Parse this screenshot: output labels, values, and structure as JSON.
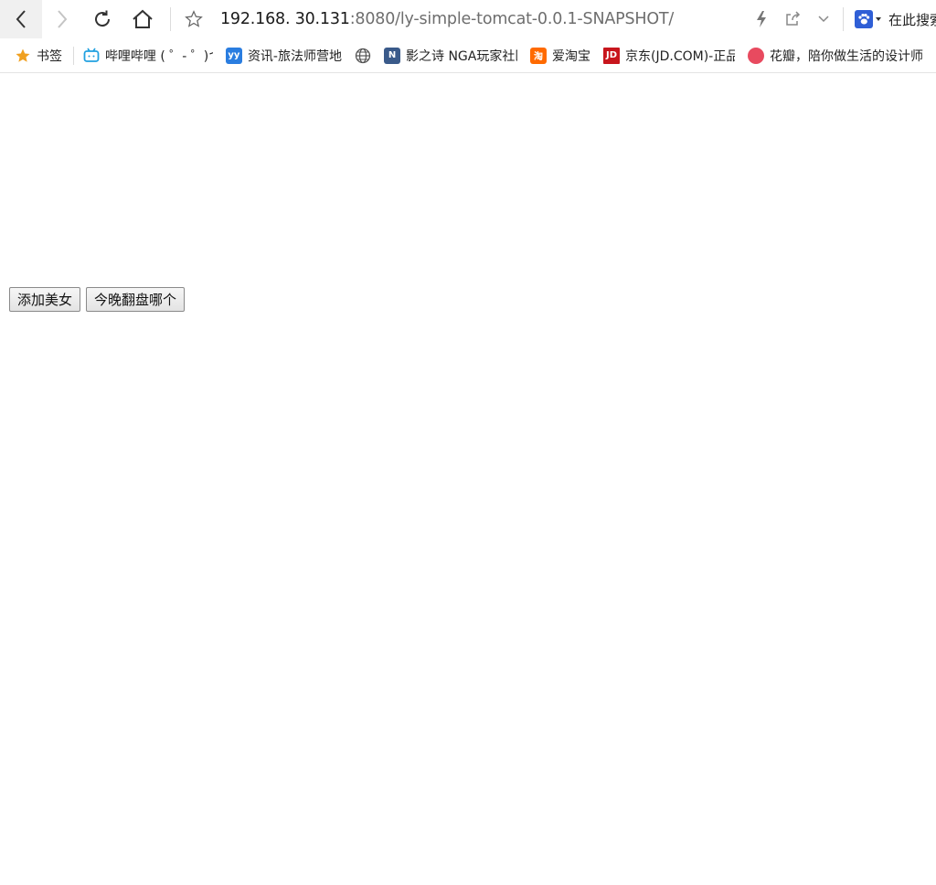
{
  "toolbar": {
    "url_host": "192.168. 30.131",
    "url_path": ":8080/ly-simple-tomcat-0.0.1-SNAPSHOT/",
    "search_text": "在此搜索"
  },
  "bookmarks": [
    {
      "label": "书签",
      "icon": "star-icon",
      "color": "#f0a020",
      "max": 40
    },
    {
      "label": "哔哩哔哩 ( ゜- ゜)つ",
      "icon": "bilibili-icon",
      "color": "#20a0e0",
      "max": 118
    },
    {
      "label": "资讯-旅法师营地",
      "icon": "camp-icon",
      "color": "#2a7de0",
      "max": 115
    },
    {
      "label": "",
      "icon": "globe-icon",
      "color": "#555555",
      "max": 0
    },
    {
      "label": "影之诗 NGA玩家社区",
      "icon": "nga-icon",
      "color": "#3a5a8a",
      "max": 120
    },
    {
      "label": "爱淘宝",
      "icon": "taobao-icon",
      "color": "#ff6a00",
      "max": 50
    },
    {
      "label": "京东(JD.COM)-正品低价",
      "icon": "jd-icon",
      "color": "#c8161d",
      "max": 120
    },
    {
      "label": "花瓣，陪你做生活的设计师",
      "icon": "huaban-icon",
      "color": "#e84a5f",
      "max": 125
    }
  ],
  "buttons": {
    "add": "添加美女",
    "pick": "今晚翻盘哪个"
  }
}
